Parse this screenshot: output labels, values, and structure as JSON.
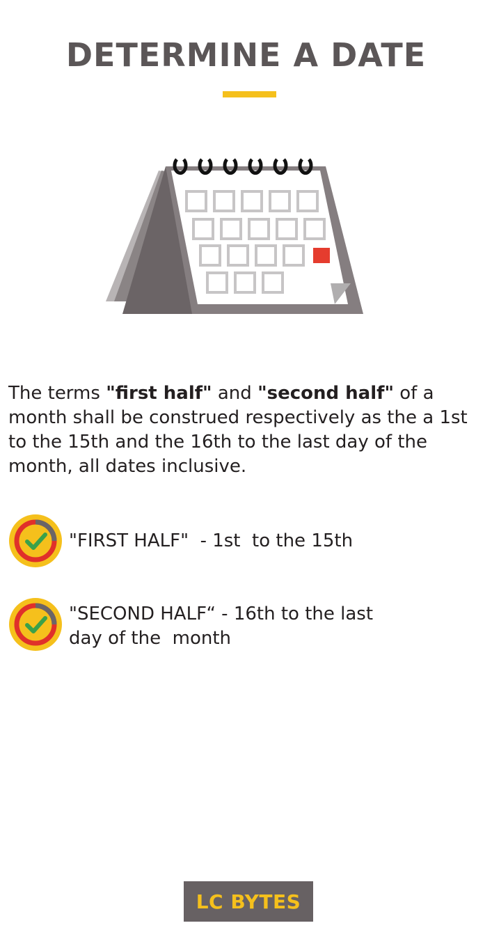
{
  "title": "DETERMINE A DATE",
  "paragraph": {
    "t1": "The terms ",
    "b1": "\"first half\"",
    "t2": " and ",
    "b2": "\"second half\"",
    "t3": " of a month shall be construed respectively as the a 1st  to the 15th and the 16th to the last day of the month, all dates inclusive."
  },
  "items": [
    {
      "text": "\"FIRST HALF\"  - 1st  to the 15th"
    },
    {
      "line1": "\"SECOND HALF“ - 16th to the last",
      "line2": "day of the  month"
    }
  ],
  "footer": {
    "label": "LC BYTES"
  },
  "colors": {
    "accent": "#f5c01c",
    "title": "#5b5657",
    "highlight_day": "#e53c2e",
    "check": "#3aa14a",
    "ring_red": "#e0302a",
    "ring_gray": "#6b6567"
  },
  "icons": [
    "calendar-icon",
    "check-badge-icon"
  ]
}
